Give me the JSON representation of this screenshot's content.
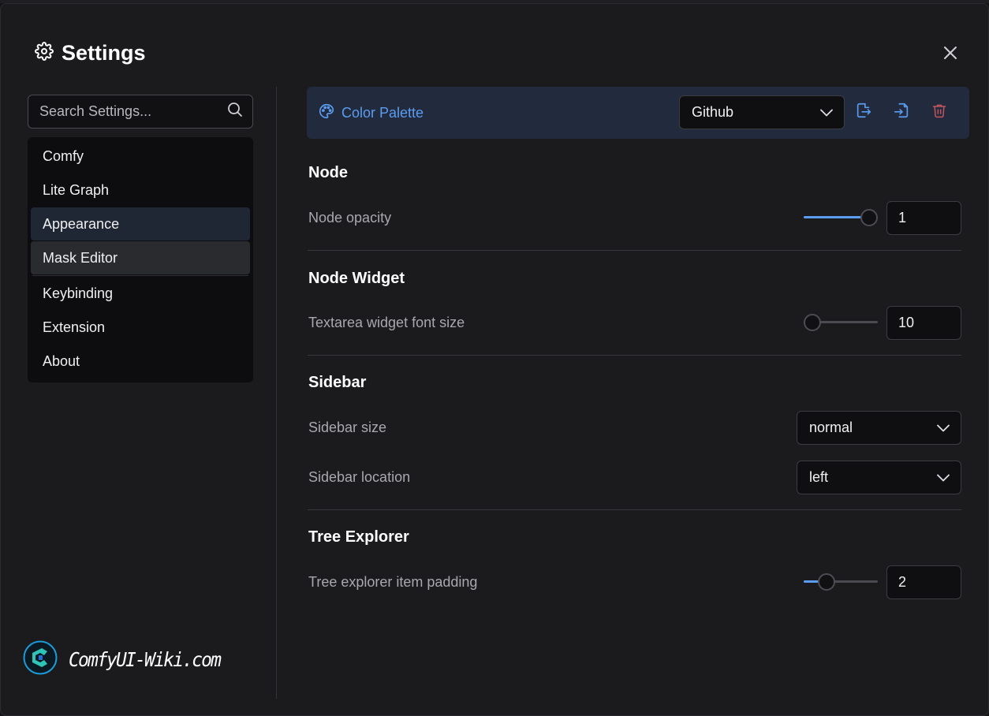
{
  "header": {
    "title": "Settings",
    "icon": "gear-icon",
    "close_icon": "close-icon"
  },
  "search": {
    "placeholder": "Search Settings...",
    "value": "",
    "icon": "search-icon"
  },
  "categories": [
    {
      "label": "Comfy"
    },
    {
      "label": "Lite Graph"
    },
    {
      "label": "Appearance",
      "state": "selected"
    },
    {
      "label": "Mask Editor",
      "state": "hover"
    },
    {
      "label": "Keybinding"
    },
    {
      "label": "Extension"
    },
    {
      "label": "About"
    }
  ],
  "palette": {
    "label": "Color Palette",
    "icon": "palette-icon",
    "selected": "Github",
    "actions": [
      "export-icon",
      "import-icon",
      "trash-icon"
    ]
  },
  "sections": {
    "node": {
      "title": "Node",
      "opacity": {
        "label": "Node opacity",
        "value": "1",
        "fraction": 1.0
      }
    },
    "node_widget": {
      "title": "Node Widget",
      "font_size": {
        "label": "Textarea widget font size",
        "value": "10",
        "fraction": 0.0
      }
    },
    "sidebar": {
      "title": "Sidebar",
      "size": {
        "label": "Sidebar size",
        "value": "normal"
      },
      "location": {
        "label": "Sidebar location",
        "value": "left"
      }
    },
    "tree_explorer": {
      "title": "Tree Explorer",
      "padding": {
        "label": "Tree explorer item padding",
        "value": "2",
        "fraction": 0.25
      }
    }
  },
  "brand": {
    "name": "ComfyUI-Wiki.com",
    "icon": "comfyui-logo-icon"
  },
  "colors": {
    "accent": "#5b9cf0",
    "danger": "#c2545e",
    "panel": "#1b1b1e",
    "palette_bar": "#222b3d",
    "selected_item": "#1f2735"
  }
}
